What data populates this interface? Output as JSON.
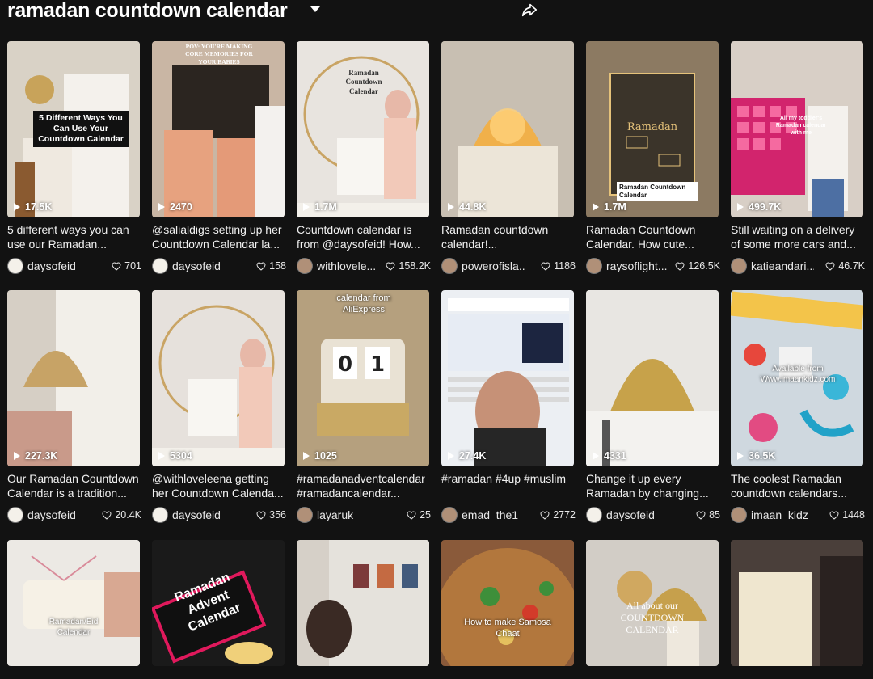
{
  "header": {
    "title": "ramadan countdown calendar"
  },
  "rows": [
    [
      {
        "overlay": "5 Different Ways You Can Use Your Countdown Calendar",
        "views": "17.5K",
        "caption": "5 different ways you can use our Ramadan...",
        "user": "daysofeid",
        "likes": "701",
        "bg": "#d9d2c6"
      },
      {
        "overlay": "POV: YOU'RE MAKING CORE MEMORIES FOR YOUR BABIES",
        "views": "2470",
        "caption": "@salialdigs setting up her Countdown Calendar la...",
        "user": "daysofeid",
        "likes": "158",
        "bg": "#c9b6a4"
      },
      {
        "overlay": "Ramadan Countdown Calendar",
        "views": "1.7M",
        "caption": "Countdown calendar is from @daysofeid! How...",
        "user": "withlovele...",
        "likes": "158.2K",
        "bg": "#e8e4df"
      },
      {
        "overlay": "",
        "views": "44.8K",
        "caption": "Ramadan countdown calendar!...",
        "user": "powerofisla...",
        "likes": "1186",
        "bg": "#bdb4a8"
      },
      {
        "overlay": "Ramadan Countdown Calendar",
        "views": "1.7M",
        "caption": "Ramadan Countdown Calendar. How cute...",
        "user": "raysoflight...",
        "likes": "126.5K",
        "bg": "#8c7a62"
      },
      {
        "overlay": "All my toddler's Ramadan calendar with me",
        "views": "499.7K",
        "caption": "Still waiting on a delivery of some more cars and...",
        "user": "katieandari...",
        "likes": "46.7K",
        "bg": "#d8cfc6"
      }
    ],
    [
      {
        "overlay": "",
        "views": "227.3K",
        "caption": "Our Ramadan Countdown Calendar is a tradition...",
        "user": "daysofeid",
        "likes": "20.4K",
        "bg": "#d6cfc5"
      },
      {
        "overlay": "",
        "views": "5304",
        "caption": "@withloveleena getting her Countdown Calenda...",
        "user": "daysofeid",
        "likes": "356",
        "bg": "#e6e1dc"
      },
      {
        "overlay": "calendar from AliExpress",
        "views": "1025",
        "caption": "#ramadanadventcalendar #ramadancalendar...",
        "user": "layaruk",
        "likes": "25",
        "bg": "#a89474"
      },
      {
        "overlay": "",
        "views": "27.4K",
        "caption": "#ramadan #4up #muslim",
        "user": "emad_the1",
        "likes": "2772",
        "bg": "#eceff3"
      },
      {
        "overlay": "",
        "views": "4331",
        "caption": "Change it up every Ramadan by changing...",
        "user": "daysofeid",
        "likes": "85",
        "bg": "#e4e2de"
      },
      {
        "overlay": "Available from Www.imaankidz.com",
        "views": "36.5K",
        "caption": "The coolest Ramadan countdown calendars...",
        "user": "imaan_kidz",
        "likes": "1448",
        "bg": "#cfd8df"
      }
    ],
    [
      {
        "overlay": "Ramadan/Eid Calendar",
        "bg": "#ece9e4"
      },
      {
        "overlay": "Ramadan Advent Calendar",
        "bg": "#1a1a1a"
      },
      {
        "overlay": "",
        "bg": "#d6d0c8"
      },
      {
        "overlay": "How to make Samosa Chaat",
        "bg": "#8a5a3a"
      },
      {
        "overlay": "All about our COUNTDOWN CALENDAR",
        "bg": "#d2cdc6"
      },
      {
        "overlay": "",
        "bg": "#3a3330"
      }
    ]
  ],
  "colors": {
    "background": "#121212",
    "text": "#ffffff",
    "muted": "#e8e8e8"
  }
}
